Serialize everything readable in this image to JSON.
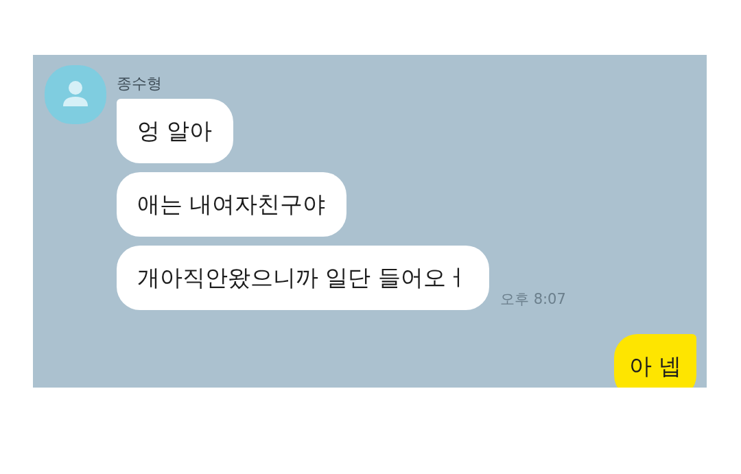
{
  "chat": {
    "contact_name": "종수형",
    "messages": [
      {
        "kind": "received",
        "text": "엉 알아"
      },
      {
        "kind": "received",
        "text": "애는 내여자친구야"
      },
      {
        "kind": "received",
        "text": "개아직안왔으니까 일단 들어오ㅓ",
        "time": "오후 8:07"
      },
      {
        "kind": "sent",
        "text": "아 넵"
      }
    ]
  }
}
